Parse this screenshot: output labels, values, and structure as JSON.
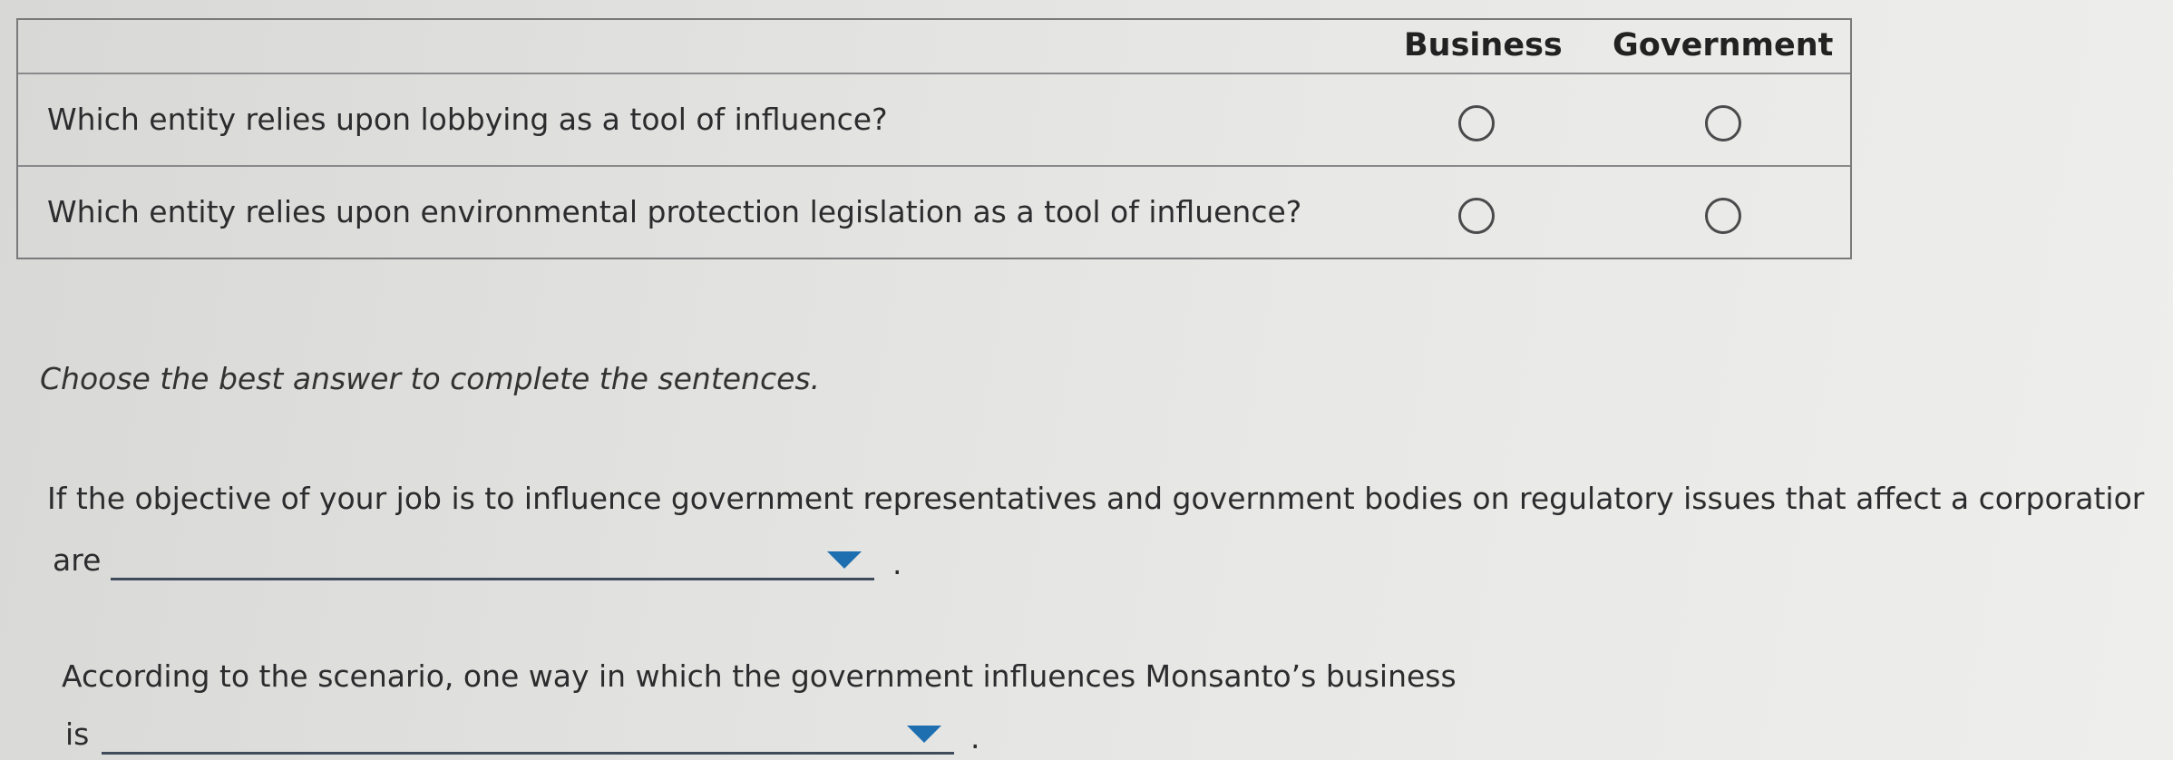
{
  "table": {
    "columns": [
      "Business",
      "Government"
    ],
    "questions": [
      {
        "text": "Which entity relies upon lobbying as a tool of influence?"
      },
      {
        "text": "Which entity relies upon environmental protection legislation as a tool of influence?"
      }
    ]
  },
  "instructions": "Choose the best answer to complete the sentences.",
  "sentences": [
    {
      "line1": "If the objective of your job is to influence government representatives and government bodies on regulatory issues that affect a corporatior",
      "line2_prefix": "are",
      "selected_value": "",
      "end": "."
    },
    {
      "line1": "According to the scenario, one way in which the government influences Monsanto’s business",
      "line2_prefix": "is",
      "selected_value": "",
      "end": "."
    }
  ],
  "colors": {
    "dropdown_arrow": "#1e6fb0",
    "dropdown_underline": "#3f4a5a",
    "border": "#7a7a7c"
  },
  "icons": [
    "radio-button-icon",
    "dropdown-arrow-icon"
  ]
}
